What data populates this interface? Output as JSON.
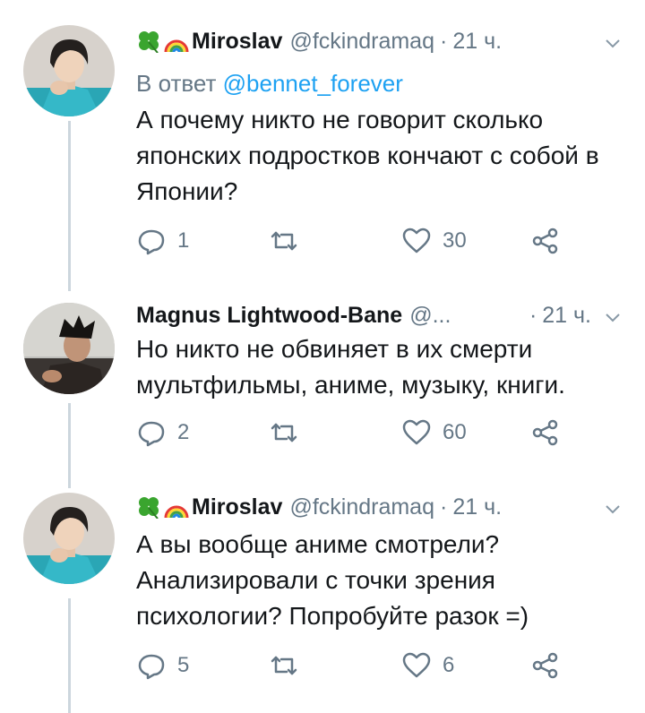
{
  "tweets": [
    {
      "name": "Miroslav",
      "handle": "@fckindramaq",
      "separator": "·",
      "time": "21 ч.",
      "reply_prefix": "В ответ",
      "reply_mention": "@bennet_forever",
      "text": "А почему никто не говорит сколько японских подростков кончают с собой в Японии?",
      "replies": "1",
      "retweets": "",
      "likes": "30"
    },
    {
      "name": "Magnus Lightwood-Bane",
      "handle": "@...",
      "separator": "·",
      "time": "21 ч.",
      "text": "Но никто не обвиняет в их смерти мультфильмы, аниме, музыку, книги.",
      "replies": "2",
      "retweets": "",
      "likes": "60"
    },
    {
      "name": "Miroslav",
      "handle": "@fckindramaq",
      "separator": "·",
      "time": "21 ч.",
      "text": "А вы вообще аниме смотрели? Анализировали с точки зрения психологии? Попробуйте разок =)",
      "replies": "5",
      "retweets": "",
      "likes": "6"
    }
  ],
  "icons": {
    "clover": "four-leaf-clover-icon",
    "rainbow": "rainbow-icon",
    "chevron": "chevron-down-icon",
    "reply": "reply-icon",
    "retweet": "retweet-icon",
    "like": "heart-icon",
    "share": "share-icon"
  },
  "colors": {
    "link": "#1da1f2",
    "muted": "#657786",
    "thread_line": "#ccd6dd",
    "text": "#14171a"
  }
}
